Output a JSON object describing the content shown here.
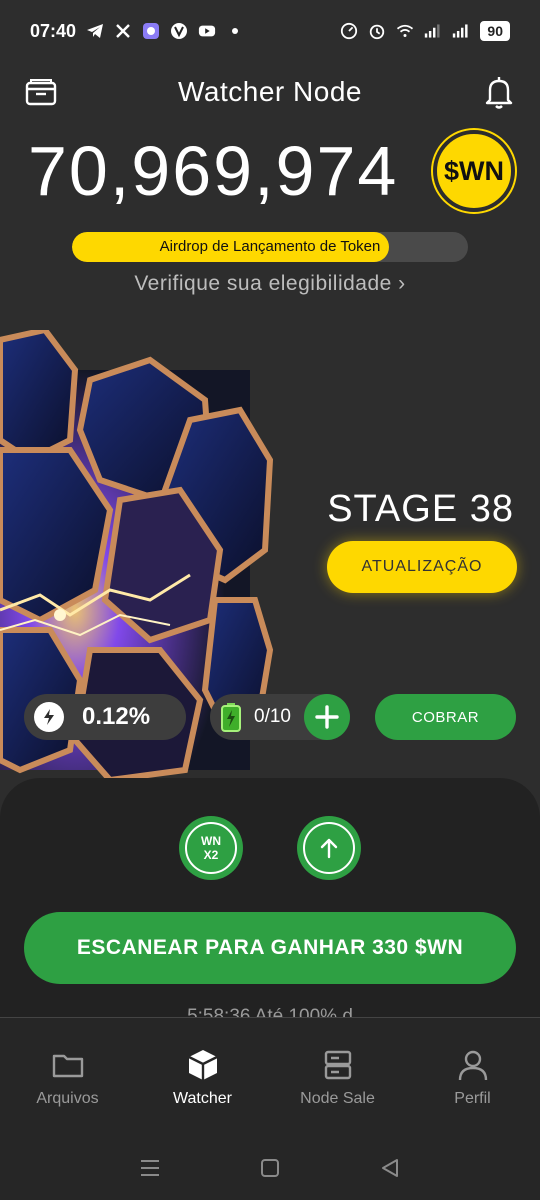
{
  "status_bar": {
    "time": "07:40",
    "battery": "90"
  },
  "header": {
    "title": "Watcher Node"
  },
  "balance": {
    "amount": "70,969,974",
    "token": "$WN"
  },
  "airdrop": {
    "label": "Airdrop de Lançamento de Token",
    "progress": 0.8
  },
  "verify_link": "Verifique sua elegibilidade ›",
  "stage": {
    "title": "STAGE 38",
    "upgrade_label": "ATUALIZAÇÃO"
  },
  "stats": {
    "rate": "0.12%",
    "energy": "0/10",
    "collect_label": "COBRAR"
  },
  "boosts": {
    "x2_line1": "WN",
    "x2_line2": "X2"
  },
  "scan": {
    "label": "ESCANEAR PARA GANHAR 330 $WN",
    "partial_text": "5:58:36 Até 100% d"
  },
  "nav": {
    "items": [
      {
        "label": "Arquivos",
        "icon": "folder-icon"
      },
      {
        "label": "Watcher",
        "icon": "cube-icon"
      },
      {
        "label": "Node Sale",
        "icon": "server-icon"
      },
      {
        "label": "Perfil",
        "icon": "user-icon"
      }
    ],
    "active": "Watcher"
  },
  "colors": {
    "accent_yellow": "#fed800",
    "accent_green": "#2ea043",
    "background": "#2d2d2d"
  }
}
